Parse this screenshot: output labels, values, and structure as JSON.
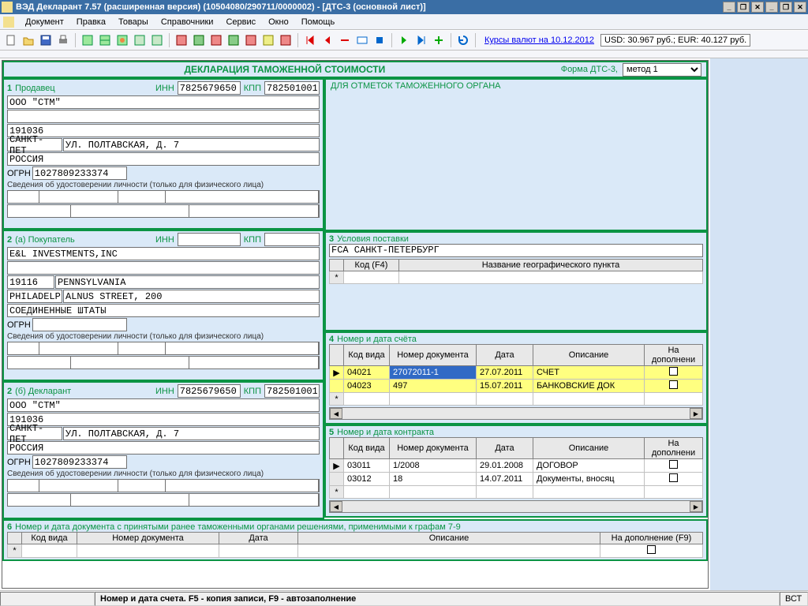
{
  "titlebar": {
    "text": "ВЭД Декларант 7.57 (расширенная версия) (10504080/290711/0000002) - [ДТС-3 (основной лист)]"
  },
  "menu": {
    "items": [
      "Документ",
      "Правка",
      "Товары",
      "Справочники",
      "Сервис",
      "Окно",
      "Помощь"
    ]
  },
  "toolbar": {
    "ratesLink": "Курсы валют на 10.12.2012",
    "usd": "USD: 30.967 руб.",
    "eur": "EUR: 40.127 руб."
  },
  "declaration": {
    "title": "ДЕКЛАРАЦИЯ ТАМОЖЕННОЙ СТОИМОСТИ",
    "formLabel": "Форма ДТС-3,",
    "method": "метод 1"
  },
  "seller": {
    "num": "1",
    "label": "Продавец",
    "innLabel": "ИНН",
    "inn": "7825679650",
    "kppLabel": "КПП",
    "kpp": "782501001",
    "company": "ООО \"СТМ\"",
    "zip": "191036",
    "city": "САНКТ-ПЕТ",
    "street": "УЛ. ПОЛТАВСКАЯ, Д. 7",
    "country": "РОССИЯ",
    "ogrnLabel": "ОГРН",
    "ogrn": "1027809233374",
    "identityNote": "Сведения об удостоверении личности (только для физического лица)"
  },
  "buyer": {
    "num": "2",
    "label": "(а) Покупатель",
    "innLabel": "ИНН",
    "kppLabel": "КПП",
    "company": "E&L INVESTMENTS,INC",
    "zip": "19116",
    "region": "PENNSYLVANIA",
    "city": "PHILADELP",
    "street": "ALNUS STREET, 200",
    "country": "СОЕДИНЕННЫЕ ШТАТЫ",
    "ogrnLabel": "ОГРН",
    "identityNote": "Сведения об удостоверении личности (только для физического лица)"
  },
  "declarant": {
    "num": "2",
    "label": "(б) Декларант",
    "innLabel": "ИНН",
    "inn": "7825679650",
    "kppLabel": "КПП",
    "kpp": "782501001",
    "company": "ООО \"СТМ\"",
    "zip": "191036",
    "city": "САНКТ-ПЕТ",
    "street": "УЛ. ПОЛТАВСКАЯ, Д. 7",
    "country": "РОССИЯ",
    "ogrnLabel": "ОГРН",
    "ogrn": "1027809233374",
    "identityNote": "Сведения об удостоверении личности (только для физического лица)"
  },
  "customsMarks": {
    "title": "ДЛЯ ОТМЕТОК ТАМОЖЕННОГО ОРГАНА"
  },
  "delivery": {
    "num": "3",
    "label": "Условия поставки",
    "terms": "FCA САНКТ-ПЕТЕРБУРГ",
    "codeHeader": "Код (F4)",
    "nameHeader": "Название географического пункта"
  },
  "accounts": {
    "num": "4",
    "label": "Номер и дата счёта",
    "headers": [
      "Код вида",
      "Номер документа",
      "Дата",
      "Описание",
      "На дополнени"
    ],
    "rows": [
      {
        "code": "04021",
        "doc": "27072011-1",
        "date": "27.07.2011",
        "desc": "СЧЕТ",
        "selected": true
      },
      {
        "code": "04023",
        "doc": "497",
        "date": "15.07.2011",
        "desc": "БАНКОВСКИЕ ДОК"
      }
    ]
  },
  "contracts": {
    "num": "5",
    "label": "Номер и дата контракта",
    "headers": [
      "Код вида",
      "Номер документа",
      "Дата",
      "Описание",
      "На дополнени"
    ],
    "rows": [
      {
        "code": "03011",
        "doc": "1/2008",
        "date": "29.01.2008",
        "desc": "ДОГОВОР"
      },
      {
        "code": "03012",
        "doc": "18",
        "date": "14.07.2011",
        "desc": "Документы, вносяц"
      }
    ]
  },
  "section6": {
    "num": "6",
    "label": "Номер и дата документа с принятыми ранее таможенными органами решениями, применимыми к графам 7-9",
    "headers": [
      "Код вида",
      "Номер документа",
      "Дата",
      "Описание",
      "На дополнение (F9)"
    ]
  },
  "statusbar": {
    "text": "Номер и дата счета. F5 - копия записи, F9 - автозаполнение",
    "end": "ВСТ"
  }
}
